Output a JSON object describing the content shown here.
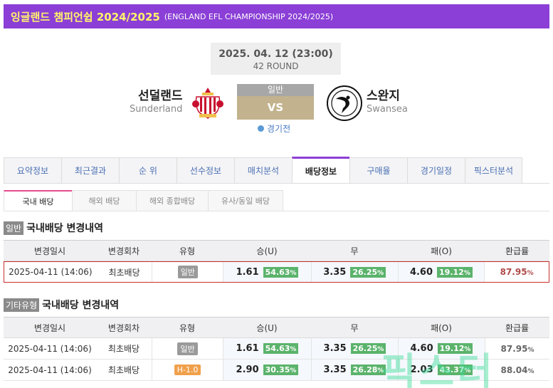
{
  "header": {
    "title": "잉글랜드 챔피언쉽 2024/2025",
    "subtitle": "(ENGLAND EFL CHAMPIONSHIP 2024/2025)"
  },
  "match": {
    "datetime": "2025. 04. 12 (23:00)",
    "round": "42 ROUND",
    "home": {
      "name": "선덜랜드",
      "name_en": "Sunderland"
    },
    "away": {
      "name": "스완지",
      "name_en": "Swansea"
    },
    "type_label": "일반",
    "vs": "VS",
    "status": "경기전"
  },
  "tabs": [
    "요약정보",
    "최근결과",
    "순 위",
    "선수정보",
    "매치분석",
    "배당정보",
    "구매율",
    "경기일정",
    "픽스터분석"
  ],
  "active_tab": "배당정보",
  "sub_tabs": [
    "국내 배당",
    "해외 배당",
    "해외 종합배당",
    "유사/동일 배당"
  ],
  "active_sub_tab": "국내 배당",
  "columns": [
    "변경일시",
    "변경회차",
    "유형",
    "승(U)",
    "무",
    "패(O)",
    "환급률"
  ],
  "section1": {
    "tag": "일반",
    "title": "국내배당 변경내역",
    "rows": [
      {
        "date": "2025-04-11 (14:06)",
        "round": "최초배당",
        "type": "일반",
        "win": "1.61",
        "win_pct": "54.63",
        "draw": "3.35",
        "draw_pct": "26.25",
        "lose": "4.60",
        "lose_pct": "19.12",
        "refund": "87.95"
      }
    ]
  },
  "section2": {
    "tag": "기타유형",
    "title": "국내배당 변경내역",
    "rows": [
      {
        "date": "2025-04-11 (14:06)",
        "round": "최초배당",
        "type": "일반",
        "win": "1.61",
        "win_pct": "54.63",
        "draw": "3.35",
        "draw_pct": "26.25",
        "lose": "4.60",
        "lose_pct": "19.12",
        "refund": "87.95"
      },
      {
        "date": "2025-04-11 (14:06)",
        "round": "최초배당",
        "type": "H-1.0",
        "win": "2.90",
        "win_pct": "30.35",
        "draw": "3.35",
        "draw_pct": "26.28",
        "lose": "2.03",
        "lose_pct": "43.37",
        "refund": "88.04"
      }
    ]
  },
  "units": {
    "percent": "%"
  },
  "watermark": "픽스터",
  "colors": {
    "header_bg": "#8b3fd6",
    "header_title": "#fff46a",
    "pct_green": "#5bb36b",
    "refund_red": "#b04a4a",
    "highlight_border": "#c9302c",
    "badge_orange": "#f0a04b"
  }
}
